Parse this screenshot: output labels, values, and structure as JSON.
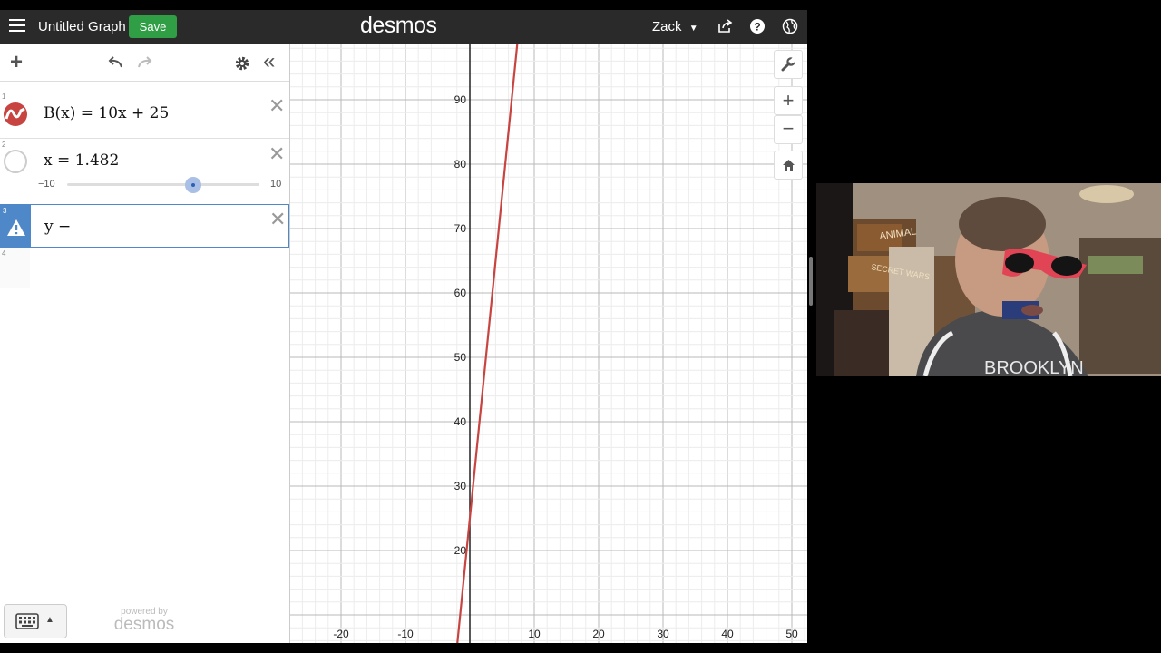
{
  "header": {
    "title": "Untitled Graph",
    "save_label": "Save",
    "logo": "desmos",
    "user": "Zack",
    "icons": [
      "menu-icon",
      "share-icon",
      "help-icon",
      "globe-icon"
    ]
  },
  "toolbar": {
    "icons": [
      "add-icon",
      "undo-icon",
      "redo-icon",
      "gear-icon",
      "collapse-icon"
    ]
  },
  "expressions": [
    {
      "num": "1",
      "latex_text": "B(x) = 10x + 25",
      "color": "#c74440"
    },
    {
      "num": "2",
      "latex_text": "x = 1.482",
      "slider": {
        "min": "−10",
        "max": "10",
        "value": 1.482
      }
    },
    {
      "num": "3",
      "latex_text": "y −",
      "warning": true
    },
    {
      "num": "4",
      "latex_text": ""
    }
  ],
  "graph": {
    "x_ticks": [
      "-20",
      "-10",
      "10",
      "20",
      "30",
      "40",
      "50"
    ],
    "y_ticks": [
      "20",
      "30",
      "40",
      "50",
      "60",
      "70",
      "80",
      "90"
    ],
    "line_color": "#c74440",
    "line_label": "B(x) = 10x + 25"
  },
  "zoom_controls": [
    "wrench-icon",
    "zoom-in-icon",
    "zoom-out-icon",
    "home-icon"
  ],
  "footer": {
    "powered_by": "powered by",
    "brand": "desmos"
  },
  "webcam": {
    "box_labels": [
      "ANIMAL",
      "SECRET WARS"
    ],
    "shirt_text": "BROOKLYN"
  }
}
